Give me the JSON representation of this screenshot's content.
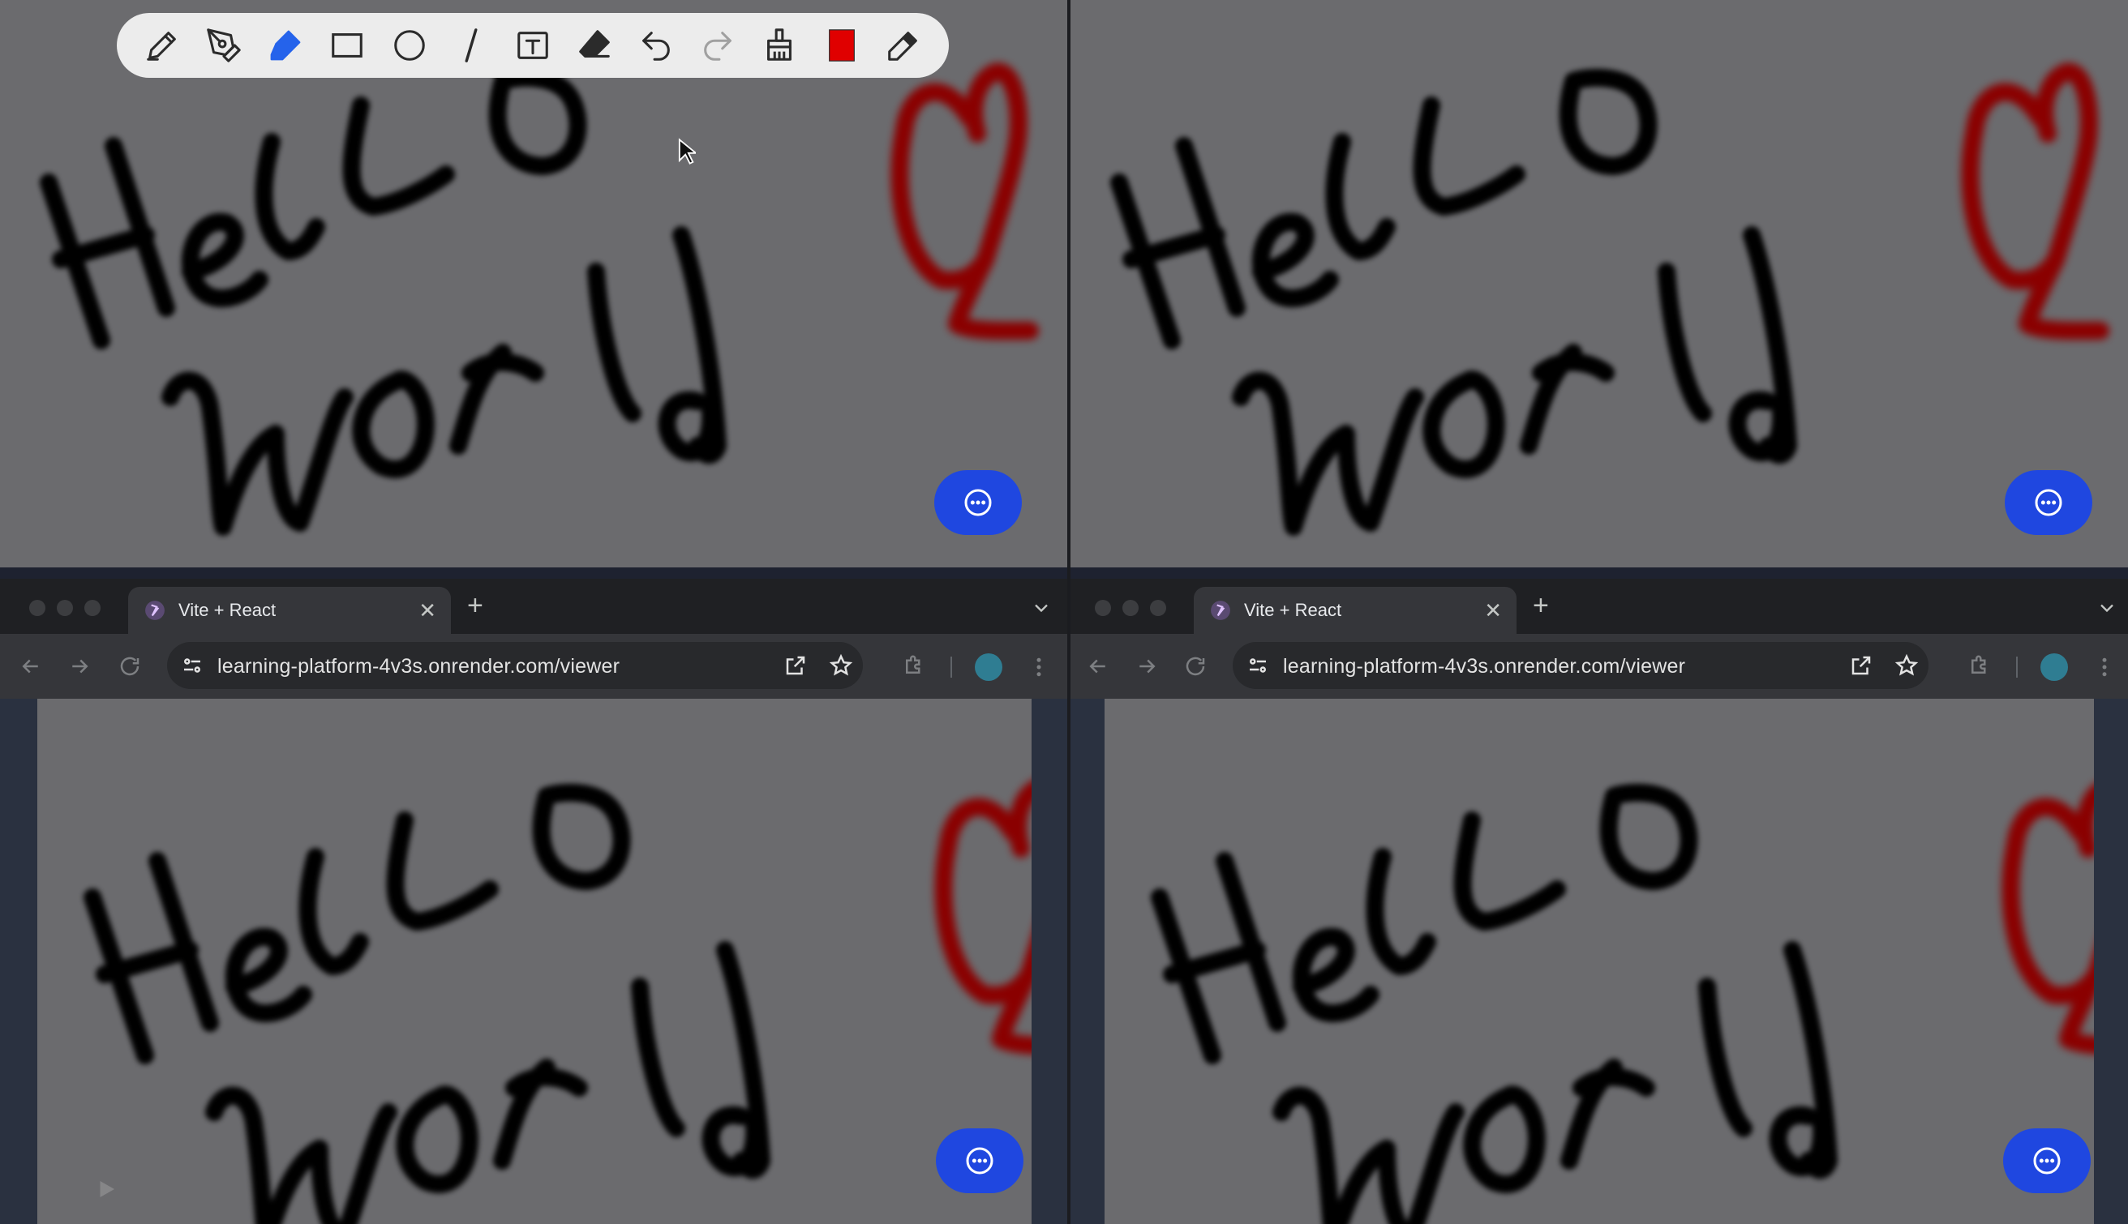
{
  "toolbar": {
    "tools": [
      "pencil",
      "pen",
      "highlighter",
      "rectangle",
      "circle",
      "line",
      "text",
      "eraser",
      "undo",
      "redo",
      "clear",
      "color",
      "color-picker"
    ],
    "active_tool": "highlighter",
    "current_color": "#e00000"
  },
  "drawing": {
    "text_strokes": "Hello World",
    "heart_color": "#8a0000",
    "ink_color": "#000000",
    "canvas_color": "#6b6b6e"
  },
  "browser_left": {
    "tab_title": "Vite + React",
    "url": "learning-platform-4v3s.onrender.com/viewer"
  },
  "browser_right": {
    "tab_title": "Vite + React",
    "url": "learning-platform-4v3s.onrender.com/viewer"
  },
  "colors": {
    "fab": "#1f47e0",
    "toolbar_active": "#2563eb"
  }
}
